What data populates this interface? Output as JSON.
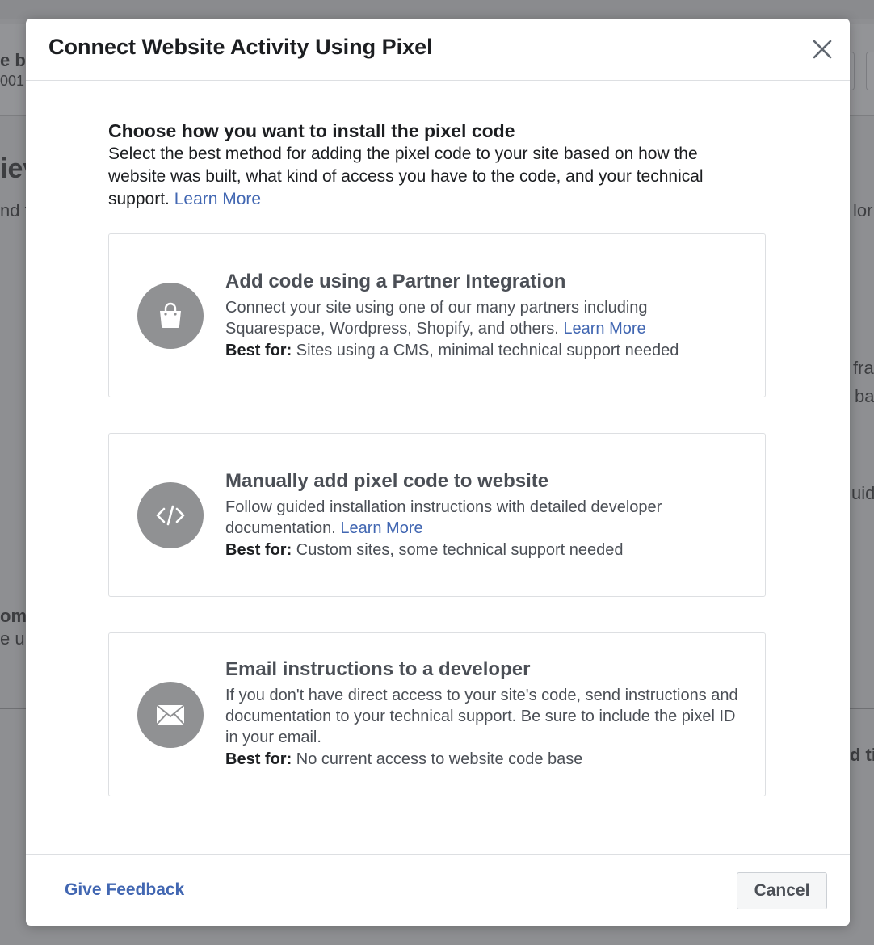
{
  "dialog": {
    "title": "Connect Website Activity Using Pixel",
    "intro": {
      "title": "Choose how you want to install the pixel code",
      "body": "Select the best method for adding the pixel code to your site based on how the website was built, what kind of access you have to the code, and your technical support. ",
      "link": "Learn More"
    },
    "options": [
      {
        "icon": "shopping-bag-icon",
        "title": "Add code using a Partner Integration",
        "desc": "Connect your site using one of our many partners including Squarespace, Wordpress, Shopify, and others. ",
        "link": "Learn More",
        "best_for_label": "Best for:",
        "best_for_value": " Sites using a CMS, minimal technical support needed"
      },
      {
        "icon": "code-icon",
        "title": "Manually add pixel code to website",
        "desc": "Follow guided installation instructions with detailed developer documentation. ",
        "link": "Learn More",
        "best_for_label": "Best for:",
        "best_for_value": " Custom sites, some technical support needed"
      },
      {
        "icon": "envelope-icon",
        "title": "Email instructions to a developer",
        "desc": "If you don't have direct access to your site's code, send instructions and documentation to your technical support. Be sure to include the pixel ID in your email.",
        "link": "",
        "best_for_label": "Best for:",
        "best_for_value": " No current access to website code base"
      }
    ],
    "footer": {
      "feedback": "Give Feedback",
      "cancel": "Cancel"
    }
  },
  "background": {
    "fragments": [
      "e b",
      "001",
      "iev",
      "nd t",
      "lor",
      "fra",
      "ba",
      "uide",
      "om",
      "e up",
      "d ti"
    ]
  },
  "colors": {
    "link": "#4267b2",
    "title": "#1c1e21",
    "body": "#4b4f56",
    "icon_circle": "#909193",
    "overlay": "#8e8f92"
  }
}
